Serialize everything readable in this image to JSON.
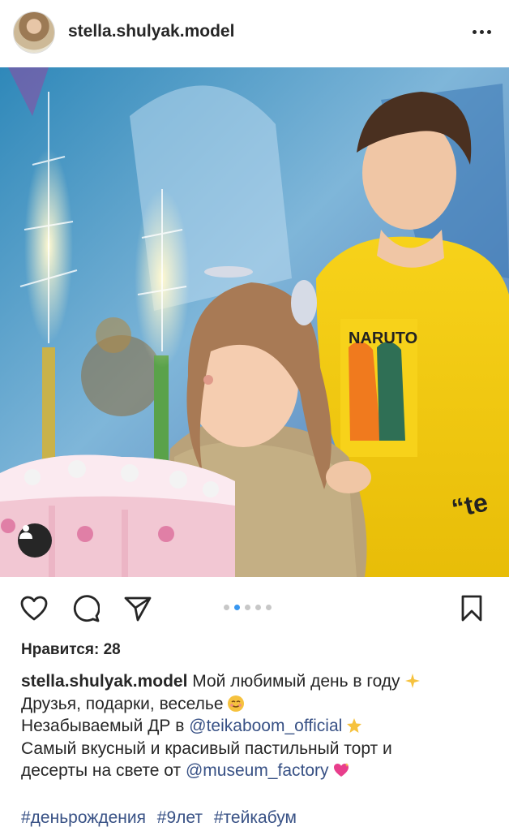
{
  "post": {
    "username": "stella.shulyak.model",
    "likes_label": "Нравится: 28",
    "caption": {
      "username": "stella.shulyak.model",
      "line1": "Мой любимый день в году",
      "line2": "Друзья, подарки, веселье",
      "line3_text": "Незабываемый ДР в",
      "line3_mention": "@teikaboom_official",
      "line4": "Самый вкусный и красивый пастильный торт и",
      "line5_text": "десерты  на свете от",
      "line5_mention": "@museum_factory"
    },
    "hashtags": [
      "#деньрождения",
      "#9лет",
      "#тейкабум"
    ],
    "carousel": {
      "count": 5,
      "active_index": 1
    },
    "photo_text": {
      "hoodie_text": "NARUTO",
      "sleeve_text": "“te"
    }
  },
  "icons": {
    "more": "more-horizontal-icon",
    "like": "heart-icon",
    "comment": "comment-icon",
    "share": "send-icon",
    "save": "bookmark-icon",
    "tag": "person-tag-icon"
  },
  "colors": {
    "link": "#385185",
    "carousel_active": "#3897f0",
    "text": "#262626"
  }
}
